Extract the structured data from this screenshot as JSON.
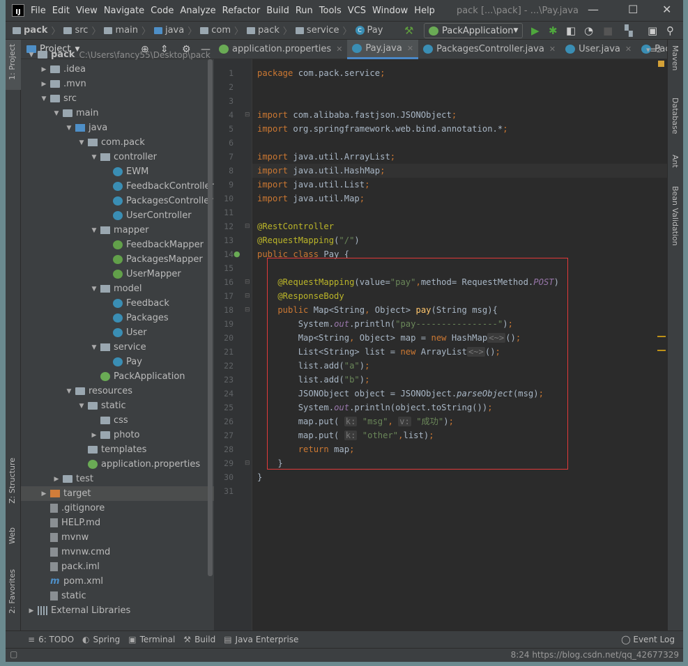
{
  "window": {
    "title": "pack [...\\pack] - ...\\Pay.java",
    "logo": "IJ"
  },
  "menu": [
    "File",
    "Edit",
    "View",
    "Navigate",
    "Code",
    "Analyze",
    "Refactor",
    "Build",
    "Run",
    "Tools",
    "VCS",
    "Window",
    "Help"
  ],
  "breadcrumb": [
    "pack",
    "src",
    "main",
    "java",
    "com",
    "pack",
    "service",
    "Pay"
  ],
  "run_config": "PackApplication",
  "project_panel": {
    "title": "Project",
    "root_path": "C:\\Users\\fancy55\\Desktop\\pack",
    "tree": [
      {
        "label": "pack",
        "depth": 0,
        "arrow": "open",
        "icon": "folder",
        "bold": true
      },
      {
        "label": ".idea",
        "depth": 1,
        "arrow": "closed",
        "icon": "folder"
      },
      {
        "label": ".mvn",
        "depth": 1,
        "arrow": "closed",
        "icon": "folder"
      },
      {
        "label": "src",
        "depth": 1,
        "arrow": "open",
        "icon": "folder"
      },
      {
        "label": "main",
        "depth": 2,
        "arrow": "open",
        "icon": "folder"
      },
      {
        "label": "java",
        "depth": 3,
        "arrow": "open",
        "icon": "src"
      },
      {
        "label": "com.pack",
        "depth": 4,
        "arrow": "open",
        "icon": "pkg"
      },
      {
        "label": "controller",
        "depth": 5,
        "arrow": "open",
        "icon": "pkg"
      },
      {
        "label": "EWM",
        "depth": 6,
        "arrow": "none",
        "icon": "class"
      },
      {
        "label": "FeedbackController",
        "depth": 6,
        "arrow": "none",
        "icon": "class"
      },
      {
        "label": "PackagesController",
        "depth": 6,
        "arrow": "none",
        "icon": "class"
      },
      {
        "label": "UserController",
        "depth": 6,
        "arrow": "none",
        "icon": "class"
      },
      {
        "label": "mapper",
        "depth": 5,
        "arrow": "open",
        "icon": "pkg"
      },
      {
        "label": "FeedbackMapper",
        "depth": 6,
        "arrow": "none",
        "icon": "iface"
      },
      {
        "label": "PackagesMapper",
        "depth": 6,
        "arrow": "none",
        "icon": "iface"
      },
      {
        "label": "UserMapper",
        "depth": 6,
        "arrow": "none",
        "icon": "iface"
      },
      {
        "label": "model",
        "depth": 5,
        "arrow": "open",
        "icon": "pkg"
      },
      {
        "label": "Feedback",
        "depth": 6,
        "arrow": "none",
        "icon": "class"
      },
      {
        "label": "Packages",
        "depth": 6,
        "arrow": "none",
        "icon": "class"
      },
      {
        "label": "User",
        "depth": 6,
        "arrow": "none",
        "icon": "class"
      },
      {
        "label": "service",
        "depth": 5,
        "arrow": "open",
        "icon": "pkg"
      },
      {
        "label": "Pay",
        "depth": 6,
        "arrow": "none",
        "icon": "class"
      },
      {
        "label": "PackApplication",
        "depth": 5,
        "arrow": "none",
        "icon": "spring"
      },
      {
        "label": "resources",
        "depth": 3,
        "arrow": "open",
        "icon": "folder"
      },
      {
        "label": "static",
        "depth": 4,
        "arrow": "open",
        "icon": "folder"
      },
      {
        "label": "css",
        "depth": 5,
        "arrow": "none",
        "icon": "folder"
      },
      {
        "label": "photo",
        "depth": 5,
        "arrow": "closed",
        "icon": "folder"
      },
      {
        "label": "templates",
        "depth": 4,
        "arrow": "none",
        "icon": "folder"
      },
      {
        "label": "application.properties",
        "depth": 4,
        "arrow": "none",
        "icon": "spring"
      },
      {
        "label": "test",
        "depth": 2,
        "arrow": "closed",
        "icon": "folder"
      },
      {
        "label": "target",
        "depth": 1,
        "arrow": "closed",
        "icon": "orange",
        "selected": true
      },
      {
        "label": ".gitignore",
        "depth": 1,
        "arrow": "none",
        "icon": "file"
      },
      {
        "label": "HELP.md",
        "depth": 1,
        "arrow": "none",
        "icon": "file"
      },
      {
        "label": "mvnw",
        "depth": 1,
        "arrow": "none",
        "icon": "file"
      },
      {
        "label": "mvnw.cmd",
        "depth": 1,
        "arrow": "none",
        "icon": "file"
      },
      {
        "label": "pack.iml",
        "depth": 1,
        "arrow": "none",
        "icon": "file"
      },
      {
        "label": "pom.xml",
        "depth": 1,
        "arrow": "none",
        "icon": "maven"
      },
      {
        "label": "static",
        "depth": 1,
        "arrow": "none",
        "icon": "file"
      },
      {
        "label": "External Libraries",
        "depth": 0,
        "arrow": "closed",
        "icon": "lib"
      }
    ]
  },
  "tabs": [
    {
      "label": "application.properties",
      "icon": "spring"
    },
    {
      "label": "Pay.java",
      "icon": "class",
      "active": true
    },
    {
      "label": "PackagesController.java",
      "icon": "class"
    },
    {
      "label": "User.java",
      "icon": "class"
    },
    {
      "label": "Pac",
      "icon": "class"
    }
  ],
  "tabs_overflow": "2",
  "editor": {
    "current_line": 8,
    "lines": [
      [
        [
          "package",
          "kw"
        ],
        [
          " com.pack.service",
          ""
        ],
        [
          ";",
          "kw"
        ]
      ],
      [],
      [],
      [
        [
          "import",
          "kw"
        ],
        [
          " com.alibaba.fastjson.JSONObject",
          ""
        ],
        [
          ";",
          "kw"
        ]
      ],
      [
        [
          "import",
          "kw"
        ],
        [
          " org.springframework.web.bind.annotation.*",
          ""
        ],
        [
          ";",
          "kw"
        ]
      ],
      [],
      [
        [
          "import",
          "kw"
        ],
        [
          " java.util.ArrayList",
          ""
        ],
        [
          ";",
          "kw"
        ]
      ],
      [
        [
          "import",
          "kw"
        ],
        [
          " java.util.HashMap",
          ""
        ],
        [
          ";",
          "kw"
        ]
      ],
      [
        [
          "import",
          "kw"
        ],
        [
          " java.util.List",
          ""
        ],
        [
          ";",
          "kw"
        ]
      ],
      [
        [
          "import",
          "kw"
        ],
        [
          " java.util.Map",
          ""
        ],
        [
          ";",
          "kw"
        ]
      ],
      [],
      [
        [
          "@RestController",
          "ann"
        ]
      ],
      [
        [
          "@RequestMapping",
          "ann"
        ],
        [
          "(",
          ""
        ],
        [
          "\"/\"",
          "str"
        ],
        [
          ")",
          ""
        ]
      ],
      [
        [
          "public class",
          "kw"
        ],
        [
          " Pay {",
          ""
        ]
      ],
      [],
      [
        [
          "    @RequestMapping",
          "ann"
        ],
        [
          "(value=",
          ""
        ],
        [
          "\"pay\"",
          "str"
        ],
        [
          ",",
          "kw"
        ],
        [
          "method= RequestMethod.",
          ""
        ],
        [
          "POST",
          "it"
        ],
        [
          ")",
          ""
        ]
      ],
      [
        [
          "    @ResponseBody",
          "ann"
        ]
      ],
      [
        [
          "    public",
          "kw"
        ],
        [
          " Map<String",
          ""
        ],
        [
          ",",
          "kw"
        ],
        [
          " Object> ",
          ""
        ],
        [
          "pay",
          "fn"
        ],
        [
          "(String msg){",
          ""
        ]
      ],
      [
        [
          "        System.",
          ""
        ],
        [
          "out",
          "it"
        ],
        [
          ".println(",
          ""
        ],
        [
          "\"pay----------------\"",
          "str"
        ],
        [
          ")",
          ""
        ],
        [
          ";",
          "kw"
        ]
      ],
      [
        [
          "        Map<String",
          ""
        ],
        [
          ",",
          "kw"
        ],
        [
          " Object> map = ",
          ""
        ],
        [
          "new",
          "kw"
        ],
        [
          " HashMap",
          ""
        ],
        [
          "<~>",
          "hint"
        ],
        [
          "()",
          ""
        ],
        [
          ";",
          "kw"
        ]
      ],
      [
        [
          "        List<String> list = ",
          ""
        ],
        [
          "new",
          "kw"
        ],
        [
          " ArrayList",
          ""
        ],
        [
          "<~>",
          "hint"
        ],
        [
          "()",
          ""
        ],
        [
          ";",
          "kw"
        ]
      ],
      [
        [
          "        list.add(",
          ""
        ],
        [
          "\"a\"",
          "str"
        ],
        [
          ")",
          ""
        ],
        [
          ";",
          "kw"
        ]
      ],
      [
        [
          "        list.add(",
          ""
        ],
        [
          "\"b\"",
          "str"
        ],
        [
          ")",
          ""
        ],
        [
          ";",
          "kw"
        ]
      ],
      [
        [
          "        JSONObject object = JSONObject.",
          ""
        ],
        [
          "parseObject",
          "it2"
        ],
        [
          "(msg)",
          ""
        ],
        [
          ";",
          "kw"
        ]
      ],
      [
        [
          "        System.",
          ""
        ],
        [
          "out",
          "it"
        ],
        [
          ".println(object.toString())",
          ""
        ],
        [
          ";",
          "kw"
        ]
      ],
      [
        [
          "        map.put( ",
          ""
        ],
        [
          "k:",
          "hint"
        ],
        [
          " ",
          ""
        ],
        [
          "\"msg\"",
          "str"
        ],
        [
          ", ",
          "kw"
        ],
        [
          "v:",
          "hint"
        ],
        [
          " ",
          ""
        ],
        [
          "\"成功\"",
          "str"
        ],
        [
          ")",
          ""
        ],
        [
          ";",
          "kw"
        ]
      ],
      [
        [
          "        map.put( ",
          ""
        ],
        [
          "k:",
          "hint"
        ],
        [
          " ",
          ""
        ],
        [
          "\"other\"",
          "str"
        ],
        [
          ",",
          "kw"
        ],
        [
          "list)",
          ""
        ],
        [
          ";",
          "kw"
        ]
      ],
      [
        [
          "        return",
          "kw"
        ],
        [
          " map",
          ""
        ],
        [
          ";",
          "kw"
        ]
      ],
      [
        [
          "    }",
          ""
        ]
      ],
      [
        [
          "}",
          ""
        ]
      ],
      []
    ]
  },
  "left_strip": {
    "project": "1: Project",
    "structure": "Z: Structure",
    "web": "Web",
    "favorites": "2: Favorites"
  },
  "right_strip": [
    "Maven",
    "Database",
    "Ant",
    "Bean Validation"
  ],
  "bottom_tools": [
    "6: TODO",
    "Spring",
    "Terminal",
    "Build",
    "Java Enterprise"
  ],
  "event_log": "Event Log",
  "status": {
    "text": "8:24  https://blog.csdn.net/qq_42677329"
  }
}
